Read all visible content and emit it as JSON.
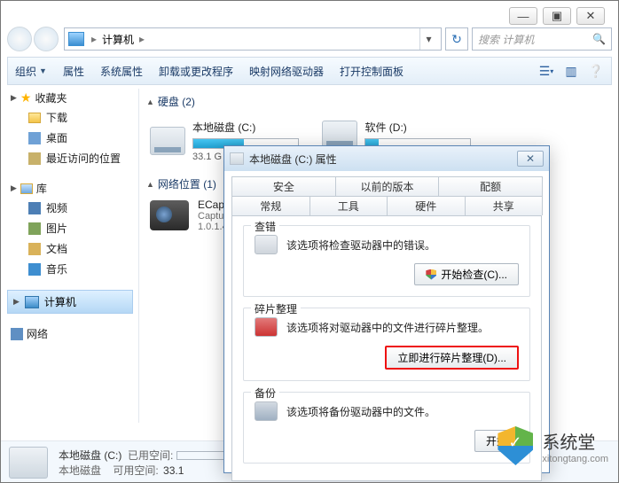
{
  "window": {
    "min": "—",
    "max": "▣",
    "close": "✕"
  },
  "address": {
    "root": "计算机",
    "search_placeholder": "搜索 计算机"
  },
  "toolbar": {
    "organize": "组织",
    "properties": "属性",
    "sys_properties": "系统属性",
    "uninstall": "卸载或更改程序",
    "map_drive": "映射网络驱动器",
    "control_panel": "打开控制面板"
  },
  "sidebar": {
    "favorites": "收藏夹",
    "downloads": "下载",
    "desktop": "桌面",
    "recent": "最近访问的位置",
    "library": "库",
    "videos": "视频",
    "pictures": "图片",
    "documents": "文档",
    "music": "音乐",
    "computer": "计算机",
    "network": "网络"
  },
  "main": {
    "hdd_section": "硬盘 (2)",
    "drive_c": {
      "name": "本地磁盘 (C:)",
      "free": "33.1 G"
    },
    "drive_d": {
      "name": "软件 (D:)"
    },
    "netloc_section": "网络位置 (1)",
    "device": {
      "name": "ECap.e",
      "sub1": "Captur",
      "sub2": "1.0.1.4"
    }
  },
  "status": {
    "name": "本地磁盘 (C:)",
    "sub": "本地磁盘",
    "used_label": "已用空间:",
    "avail_label": "可用空间:",
    "avail_value": "33.1"
  },
  "dialog": {
    "title": "本地磁盘 (C:) 属性",
    "tabs_top": {
      "security": "安全",
      "prev": "以前的版本",
      "quota": "配额"
    },
    "tabs_bottom": {
      "general": "常规",
      "tools": "工具",
      "hardware": "硬件",
      "sharing": "共享"
    },
    "check": {
      "legend": "查错",
      "desc": "该选项将检查驱动器中的错误。",
      "button": "开始检查(C)..."
    },
    "defrag": {
      "legend": "碎片整理",
      "desc": "该选项将对驱动器中的文件进行碎片整理。",
      "button": "立即进行碎片整理(D)..."
    },
    "backup": {
      "legend": "备份",
      "desc": "该选项将备份驱动器中的文件。",
      "button": "开始"
    }
  },
  "watermark": {
    "name": "系统堂",
    "url": "xitongtang.com"
  }
}
